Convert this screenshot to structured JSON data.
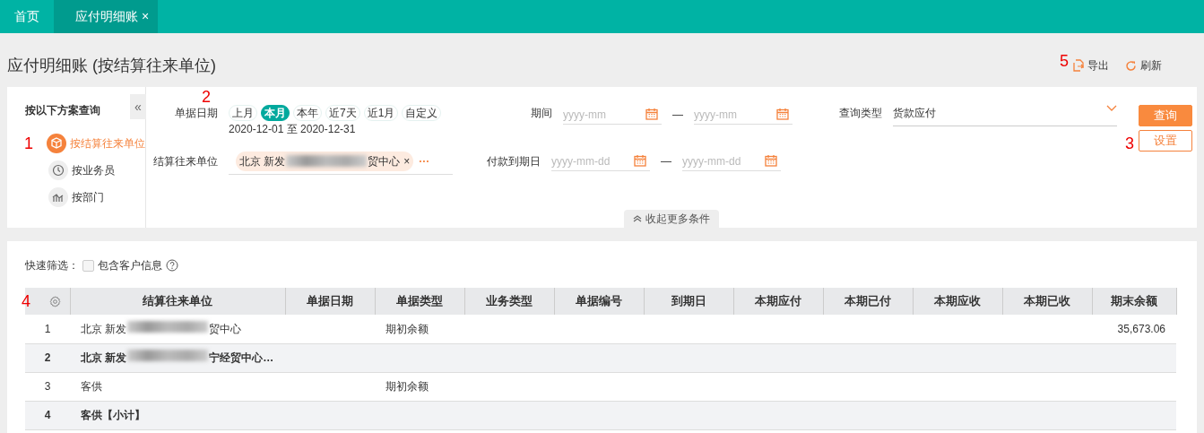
{
  "tabs": [
    {
      "label": "首页",
      "selected": false
    },
    {
      "label": "应付明细账",
      "selected": true,
      "close": "×"
    }
  ],
  "page_title": "应付明细账 (按结算往来单位)",
  "toolbar": {
    "annotation": "5",
    "actions": [
      {
        "label": "导出",
        "kind": "export"
      },
      {
        "label": "刷新",
        "kind": "refresh"
      }
    ]
  },
  "schemes": {
    "heading": "按以下方案查询",
    "collapse": "«",
    "items": [
      {
        "label": "按结算往来单位",
        "kind": "cube",
        "selected": true,
        "annotation": "1"
      },
      {
        "label": "按业务员",
        "kind": "clock",
        "selected": false
      },
      {
        "label": "按部门",
        "kind": "chart",
        "selected": false
      }
    ]
  },
  "filters": {
    "date": {
      "label": "单据日期",
      "annotation": "2",
      "chips": [
        {
          "label": "上月",
          "selected": false
        },
        {
          "label": "本月",
          "selected": true
        },
        {
          "label": "本年",
          "selected": false
        },
        {
          "label": "近7天",
          "selected": false
        },
        {
          "label": "近1月",
          "selected": false
        },
        {
          "label": "自定义",
          "selected": false
        }
      ],
      "range": "2020-12-01 至 2020-12-31"
    },
    "period": {
      "label": "期间",
      "from": {
        "placeholder": "yyyy-mm"
      },
      "separator": "—",
      "to": {
        "placeholder": "yyyy-mm"
      }
    },
    "query_type": {
      "label": "查询类型",
      "value": "货款应付"
    },
    "partner": {
      "label": "结算往来单位",
      "tag": {
        "before": "北京 新发",
        "after": "贸中心",
        "remove": "×"
      },
      "more": "···"
    },
    "due_date": {
      "label": "付款到期日",
      "from": {
        "placeholder": "yyyy-mm-dd"
      },
      "separator": "—",
      "to": {
        "placeholder": "yyyy-mm-dd"
      }
    },
    "buttons": [
      {
        "label": "查询",
        "kind": "primary"
      },
      {
        "label": "设置",
        "kind": "outline",
        "annotation": "3"
      }
    ],
    "collapse_toggle": "收起更多条件"
  },
  "quick_filter": {
    "label": "快速筛选：",
    "option": "包含客户信息",
    "checked": false
  },
  "table": {
    "settings_annotation": "4",
    "columns": [
      "结算往来单位",
      "单据日期",
      "单据类型",
      "业务类型",
      "单据编号",
      "到期日",
      "本期应付",
      "本期已付",
      "本期应收",
      "本期已收",
      "期末余额"
    ],
    "rows": [
      {
        "index": "1",
        "kind": "detail",
        "partner": {
          "before": "北京 新发",
          "after": "贸中心"
        },
        "doc_type": "期初余额",
        "ending_balance": "35,673.06"
      },
      {
        "index": "2",
        "kind": "subtotal",
        "partner": {
          "before": "北京 新发",
          "after": "宁经贸中心…"
        }
      },
      {
        "index": "3",
        "kind": "detail",
        "partner": {
          "text": "客供"
        },
        "doc_type": "期初余额"
      },
      {
        "index": "4",
        "kind": "subtotal",
        "partner": {
          "text": "客供【小计】"
        }
      }
    ]
  }
}
